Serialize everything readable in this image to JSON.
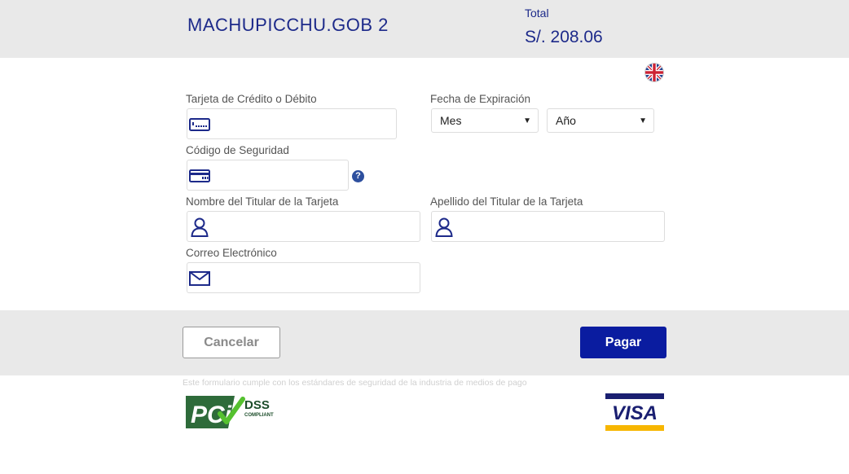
{
  "header": {
    "merchant": "MACHUPICCHU.GOB 2",
    "total_label": "Total",
    "total_amount": "S/. 208.06"
  },
  "language": {
    "icon": "uk-flag-icon"
  },
  "form": {
    "card_label": "Tarjeta de Crédito o Débito",
    "expiry_label": "Fecha de Expiración",
    "month_value": "Mes",
    "year_value": "Año",
    "cvv_label": "Código de Seguridad",
    "cvv_help": "?",
    "first_name_label": "Nombre del Titular de la Tarjeta",
    "last_name_label": "Apellido del Titular de la Tarjeta",
    "email_label": "Correo Electrónico"
  },
  "actions": {
    "cancel_label": "Cancelar",
    "pay_label": "Pagar"
  },
  "footer": {
    "disclaimer": "Este formulario cumple con los estándares de seguridad de la industria de medios de pago",
    "pci_logo": "pci-dss-compliant-logo",
    "visa_logo": "visa-logo"
  },
  "colors": {
    "accent": "#0a1ca0",
    "text_brand": "#1d2a8a",
    "band": "#e9e9e9",
    "label": "#555555"
  }
}
